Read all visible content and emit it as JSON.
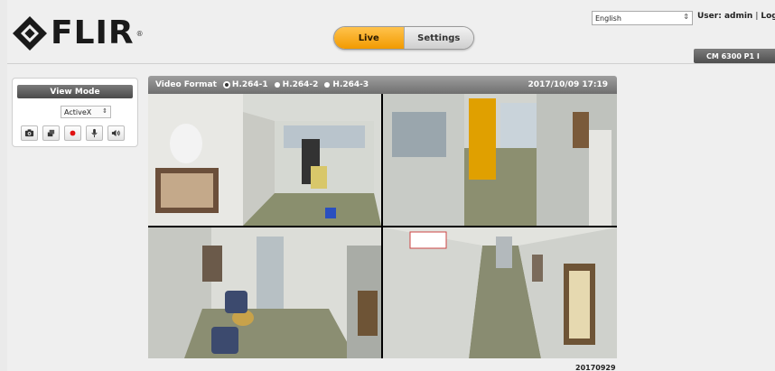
{
  "brand": {
    "name": "FLIR",
    "reg": "®"
  },
  "nav": {
    "tabs": [
      {
        "label": "Live"
      },
      {
        "label": "Settings"
      }
    ]
  },
  "header": {
    "language": "English",
    "user_label": "User: admin",
    "separator": "|",
    "logout_label": "Logout",
    "device_name": "CM 6300 P1 I"
  },
  "left_panel": {
    "view_mode_label": "View Mode",
    "viewer_option": "ActiveX",
    "controls": [
      {
        "icon": "camera-icon"
      },
      {
        "icon": "record-clip-icon"
      },
      {
        "icon": "record-dot-icon"
      },
      {
        "icon": "microphone-icon"
      },
      {
        "icon": "speaker-icon"
      }
    ]
  },
  "video": {
    "format_label": "Video Format",
    "streams": [
      "H.264-1",
      "H.264-2",
      "H.264-3"
    ],
    "selected_stream": "H.264-1",
    "timestamp": "2017/10/09 17:19",
    "date_stamp": "20170929"
  },
  "colors": {
    "accent": "#f29a00",
    "header_gray": "#6f6f6f"
  }
}
